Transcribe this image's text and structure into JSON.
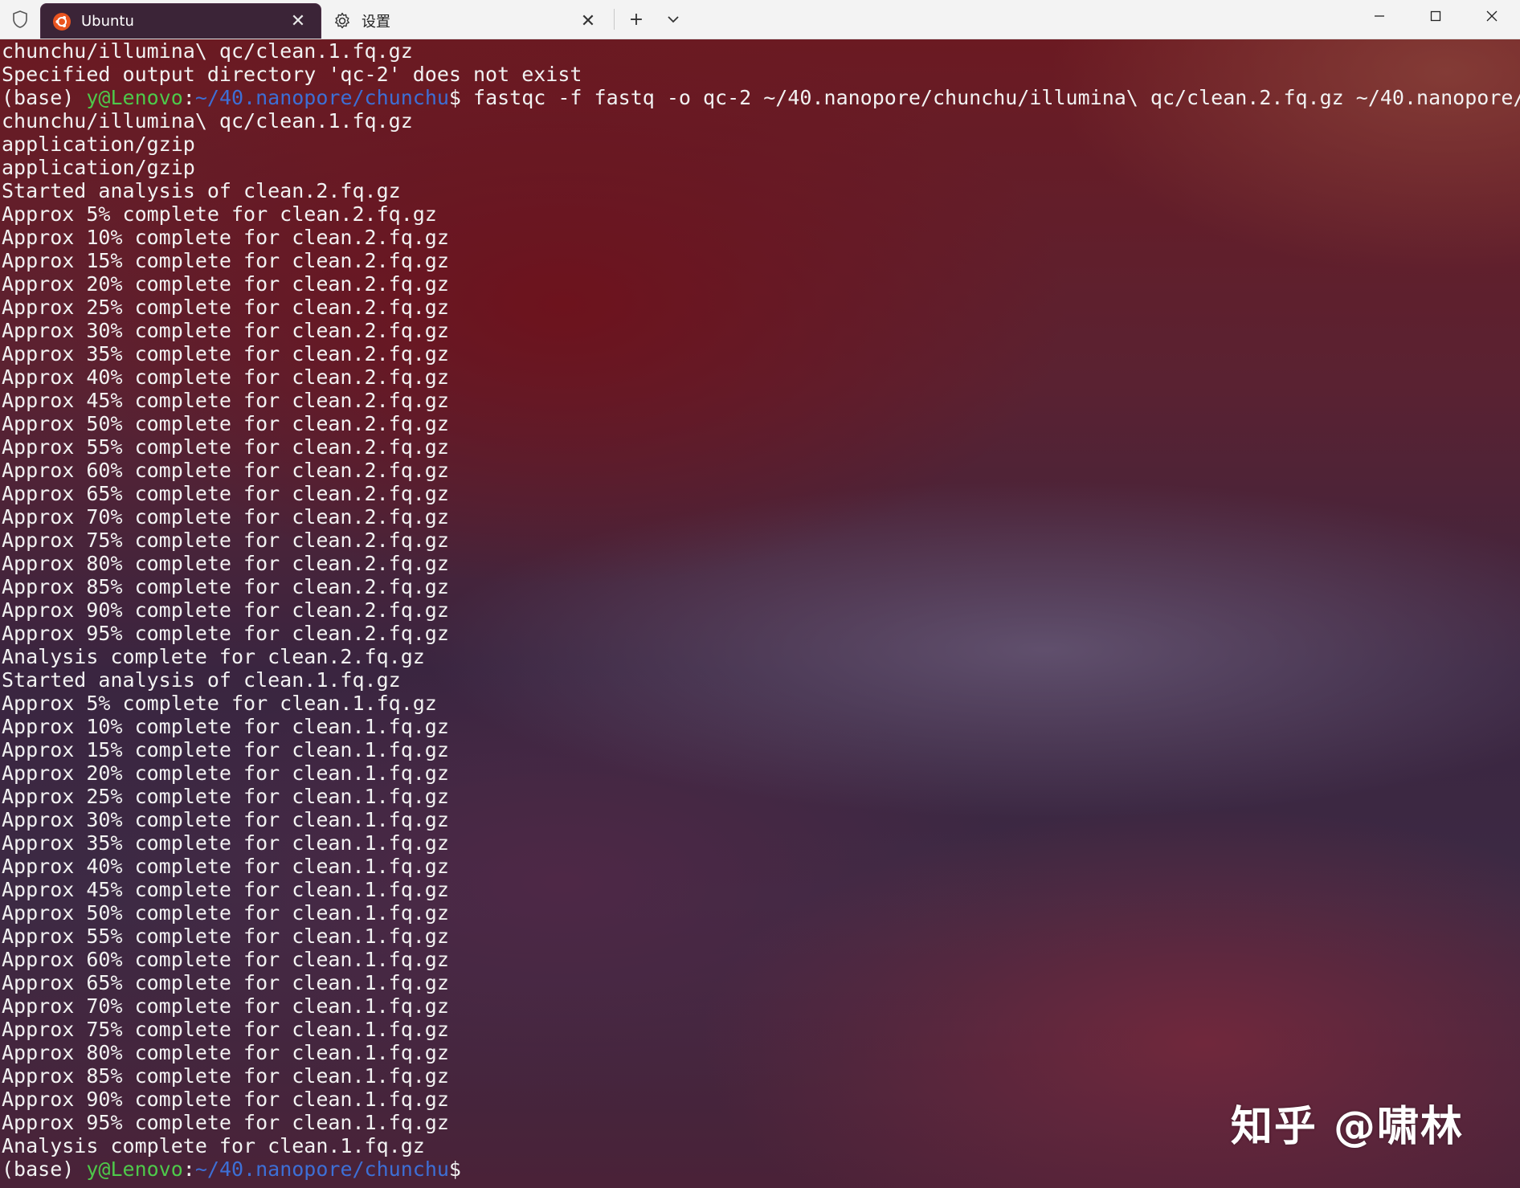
{
  "tabs": [
    {
      "label": "Ubuntu",
      "icon": "ubuntu-icon",
      "active": true
    },
    {
      "label": "设置",
      "icon": "gear-icon",
      "active": false
    }
  ],
  "toolbar": {
    "new_tab_icon": "plus-icon",
    "dropdown_icon": "chevron-down-icon"
  },
  "window_controls": [
    "minimize-icon",
    "maximize-icon",
    "close-icon"
  ],
  "colors": {
    "active_tab_bg": "#3b2437",
    "prompt_user": "#4ec94a",
    "prompt_path": "#3d6fd6",
    "terminal_text": "#f2f2f2",
    "ubuntu_orange": "#e95420"
  },
  "terminal": {
    "lines": [
      {
        "type": "text",
        "text": "chunchu/illumina\\ qc/clean.1.fq.gz"
      },
      {
        "type": "text",
        "text": "Specified output directory 'qc-2' does not exist"
      },
      {
        "type": "prompt",
        "env": "(base) ",
        "user": "y@Lenovo",
        "sep": ":",
        "path": "~/40.nanopore/chunchu",
        "cmd": "$ fastqc -f fastq -o qc-2 ~/40.nanopore/chunchu/illumina\\ qc/clean.2.fq.gz ~/40.nanopore/"
      },
      {
        "type": "text",
        "text": "chunchu/illumina\\ qc/clean.1.fq.gz"
      },
      {
        "type": "text",
        "text": "application/gzip"
      },
      {
        "type": "text",
        "text": "application/gzip"
      },
      {
        "type": "text",
        "text": "Started analysis of clean.2.fq.gz"
      },
      {
        "type": "text",
        "text": "Approx 5% complete for clean.2.fq.gz"
      },
      {
        "type": "text",
        "text": "Approx 10% complete for clean.2.fq.gz"
      },
      {
        "type": "text",
        "text": "Approx 15% complete for clean.2.fq.gz"
      },
      {
        "type": "text",
        "text": "Approx 20% complete for clean.2.fq.gz"
      },
      {
        "type": "text",
        "text": "Approx 25% complete for clean.2.fq.gz"
      },
      {
        "type": "text",
        "text": "Approx 30% complete for clean.2.fq.gz"
      },
      {
        "type": "text",
        "text": "Approx 35% complete for clean.2.fq.gz"
      },
      {
        "type": "text",
        "text": "Approx 40% complete for clean.2.fq.gz"
      },
      {
        "type": "text",
        "text": "Approx 45% complete for clean.2.fq.gz"
      },
      {
        "type": "text",
        "text": "Approx 50% complete for clean.2.fq.gz"
      },
      {
        "type": "text",
        "text": "Approx 55% complete for clean.2.fq.gz"
      },
      {
        "type": "text",
        "text": "Approx 60% complete for clean.2.fq.gz"
      },
      {
        "type": "text",
        "text": "Approx 65% complete for clean.2.fq.gz"
      },
      {
        "type": "text",
        "text": "Approx 70% complete for clean.2.fq.gz"
      },
      {
        "type": "text",
        "text": "Approx 75% complete for clean.2.fq.gz"
      },
      {
        "type": "text",
        "text": "Approx 80% complete for clean.2.fq.gz"
      },
      {
        "type": "text",
        "text": "Approx 85% complete for clean.2.fq.gz"
      },
      {
        "type": "text",
        "text": "Approx 90% complete for clean.2.fq.gz"
      },
      {
        "type": "text",
        "text": "Approx 95% complete for clean.2.fq.gz"
      },
      {
        "type": "text",
        "text": "Analysis complete for clean.2.fq.gz"
      },
      {
        "type": "text",
        "text": "Started analysis of clean.1.fq.gz"
      },
      {
        "type": "text",
        "text": "Approx 5% complete for clean.1.fq.gz"
      },
      {
        "type": "text",
        "text": "Approx 10% complete for clean.1.fq.gz"
      },
      {
        "type": "text",
        "text": "Approx 15% complete for clean.1.fq.gz"
      },
      {
        "type": "text",
        "text": "Approx 20% complete for clean.1.fq.gz"
      },
      {
        "type": "text",
        "text": "Approx 25% complete for clean.1.fq.gz"
      },
      {
        "type": "text",
        "text": "Approx 30% complete for clean.1.fq.gz"
      },
      {
        "type": "text",
        "text": "Approx 35% complete for clean.1.fq.gz"
      },
      {
        "type": "text",
        "text": "Approx 40% complete for clean.1.fq.gz"
      },
      {
        "type": "text",
        "text": "Approx 45% complete for clean.1.fq.gz"
      },
      {
        "type": "text",
        "text": "Approx 50% complete for clean.1.fq.gz"
      },
      {
        "type": "text",
        "text": "Approx 55% complete for clean.1.fq.gz"
      },
      {
        "type": "text",
        "text": "Approx 60% complete for clean.1.fq.gz"
      },
      {
        "type": "text",
        "text": "Approx 65% complete for clean.1.fq.gz"
      },
      {
        "type": "text",
        "text": "Approx 70% complete for clean.1.fq.gz"
      },
      {
        "type": "text",
        "text": "Approx 75% complete for clean.1.fq.gz"
      },
      {
        "type": "text",
        "text": "Approx 80% complete for clean.1.fq.gz"
      },
      {
        "type": "text",
        "text": "Approx 85% complete for clean.1.fq.gz"
      },
      {
        "type": "text",
        "text": "Approx 90% complete for clean.1.fq.gz"
      },
      {
        "type": "text",
        "text": "Approx 95% complete for clean.1.fq.gz"
      },
      {
        "type": "text",
        "text": "Analysis complete for clean.1.fq.gz"
      },
      {
        "type": "prompt",
        "env": "(base) ",
        "user": "y@Lenovo",
        "sep": ":",
        "path": "~/40.nanopore/chunchu",
        "cmd": "$"
      }
    ]
  },
  "watermark": "知乎 @啸林"
}
